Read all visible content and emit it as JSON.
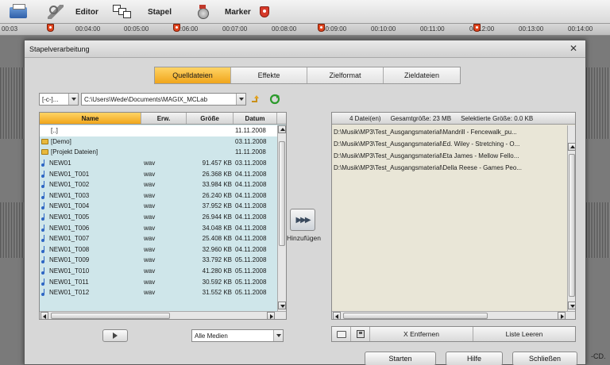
{
  "toolbar": {
    "editor_label": "Editor",
    "batch_label": "Stapel",
    "marker_label": "Marker",
    "icons": [
      "printer-icon",
      "tools-icon",
      "batch-icon",
      "marker-icon",
      "marker-badge-icon"
    ]
  },
  "ruler": {
    "ticks": [
      "00:03",
      "00:04:00",
      "00:05:00",
      "00:06:00",
      "00:07:00",
      "00:08:00",
      "00:09:00",
      "00:10:00",
      "00:11:00",
      "00:12:00",
      "00:13:00",
      "00:14:00"
    ],
    "marker_numbers": [
      "2",
      "3",
      "4",
      "5"
    ]
  },
  "dialog": {
    "title": "Stapelverarbeitung",
    "close_glyph": "✕",
    "tabs": [
      "Quelldateien",
      "Effekte",
      "Zielformat",
      "Zieldateien"
    ],
    "active_tab": "Quelldateien",
    "drive_combo": "[-c-]...",
    "path_combo": "C:\\Users\\Wede\\Documents\\MAGIX_MCLab",
    "file_list": {
      "columns": [
        "Name",
        "Erw.",
        "Größe",
        "Datum"
      ],
      "rows": [
        {
          "name": "[..]",
          "ext": "",
          "size": "",
          "date": "11.11.2008",
          "type": "parent"
        },
        {
          "name": "[Demo]",
          "ext": "",
          "size": "",
          "date": "03.11.2008",
          "type": "folder"
        },
        {
          "name": "[Projekt Dateien]",
          "ext": "",
          "size": "",
          "date": "11.11.2008",
          "type": "folder"
        },
        {
          "name": "NEW01",
          "ext": "wav",
          "size": "91.457 KB",
          "date": "03.11.2008",
          "type": "audio"
        },
        {
          "name": "NEW01_T001",
          "ext": "wav",
          "size": "26.368 KB",
          "date": "04.11.2008",
          "type": "audio"
        },
        {
          "name": "NEW01_T002",
          "ext": "wav",
          "size": "33.984 KB",
          "date": "04.11.2008",
          "type": "audio"
        },
        {
          "name": "NEW01_T003",
          "ext": "wav",
          "size": "26.240 KB",
          "date": "04.11.2008",
          "type": "audio"
        },
        {
          "name": "NEW01_T004",
          "ext": "wav",
          "size": "37.952 KB",
          "date": "04.11.2008",
          "type": "audio"
        },
        {
          "name": "NEW01_T005",
          "ext": "wav",
          "size": "26.944 KB",
          "date": "04.11.2008",
          "type": "audio"
        },
        {
          "name": "NEW01_T006",
          "ext": "wav",
          "size": "34.048 KB",
          "date": "04.11.2008",
          "type": "audio"
        },
        {
          "name": "NEW01_T007",
          "ext": "wav",
          "size": "25.408 KB",
          "date": "04.11.2008",
          "type": "audio"
        },
        {
          "name": "NEW01_T008",
          "ext": "wav",
          "size": "32.960 KB",
          "date": "04.11.2008",
          "type": "audio"
        },
        {
          "name": "NEW01_T009",
          "ext": "wav",
          "size": "33.792 KB",
          "date": "05.11.2008",
          "type": "audio"
        },
        {
          "name": "NEW01_T010",
          "ext": "wav",
          "size": "41.280 KB",
          "date": "05.11.2008",
          "type": "audio"
        },
        {
          "name": "NEW01_T011",
          "ext": "wav",
          "size": "30.592 KB",
          "date": "05.11.2008",
          "type": "audio"
        },
        {
          "name": "NEW01_T012",
          "ext": "wav",
          "size": "31.552 KB",
          "date": "05.11.2008",
          "type": "audio"
        }
      ]
    },
    "media_filter": "Alle Medien",
    "add_button_glyph": "▶▶▶",
    "add_label": "Hinzufügen",
    "target_list": {
      "file_count": "4 Datei(en)",
      "total_size": "Gesamtgröße: 23 MB",
      "selected_size": "Selektierte Größe: 0.0 KB",
      "rows": [
        "D:\\Musik\\MP3\\Test_Ausgangsmaterial\\Mandrill - Fencewalk_pu...",
        "D:\\Musik\\MP3\\Test_Ausgangsmaterial\\Ed. Wiley - Stretching - O...",
        "D:\\Musik\\MP3\\Test_Ausgangsmaterial\\Eta James - Mellow Fello...",
        "D:\\Musik\\MP3\\Test_Ausgangsmaterial\\Della Reese - Games Peo..."
      ]
    },
    "remove_label": "X  Entfernen",
    "clear_label": "Liste Leeren",
    "start_label": "Starten",
    "help_label": "Hilfe",
    "close_label": "Schließen"
  },
  "background_text": "-CD."
}
